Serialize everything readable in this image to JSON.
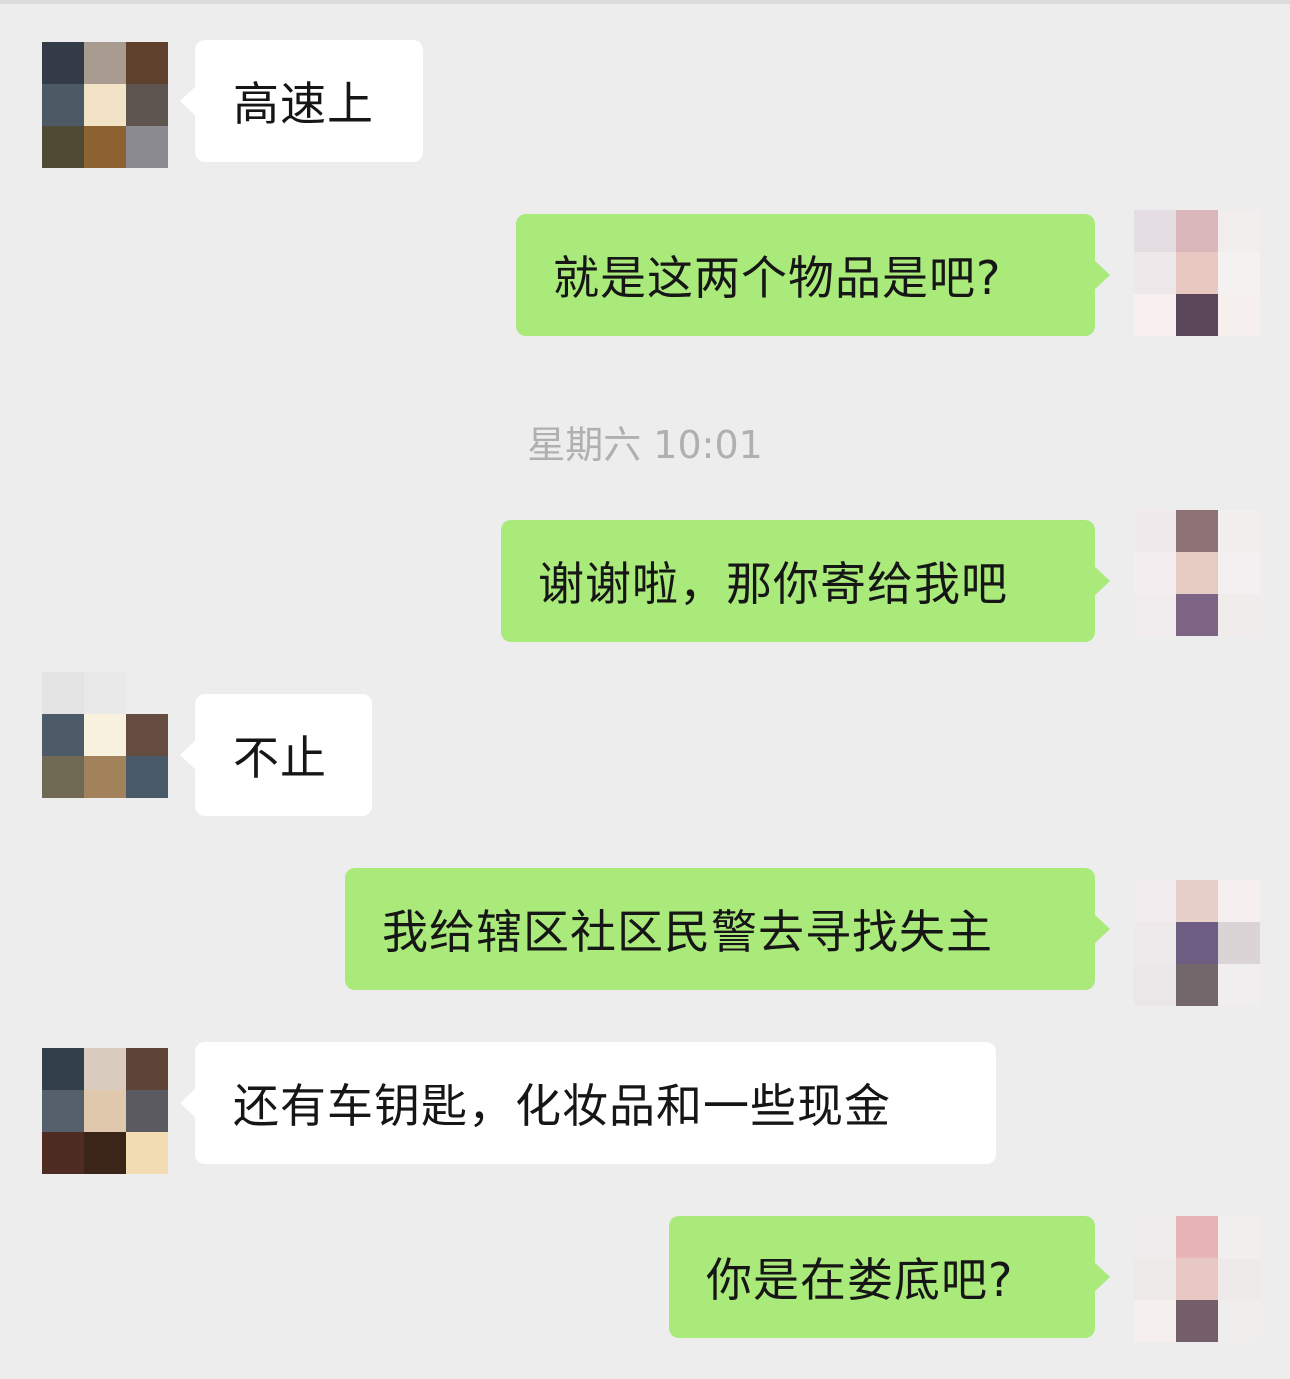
{
  "colors": {
    "background": "#ededed",
    "incoming_bubble": "#ffffff",
    "outgoing_bubble": "#a9ea7a",
    "timestamp_text": "#b0b0b0"
  },
  "timestamp": "星期六 10:01",
  "messages": [
    {
      "direction": "incoming",
      "text": "高速上"
    },
    {
      "direction": "outgoing",
      "text": "就是这两个物品是吧?"
    },
    {
      "direction": "outgoing",
      "text": "谢谢啦，那你寄给我吧"
    },
    {
      "direction": "incoming",
      "text": "不止"
    },
    {
      "direction": "outgoing",
      "text": "我给辖区社区民警去寻找失主"
    },
    {
      "direction": "incoming",
      "text": "还有车钥匙，化妆品和一些现金"
    },
    {
      "direction": "outgoing",
      "text": "你是在娄底吧?"
    }
  ],
  "avatars": {
    "contact_1": [
      "#333c46",
      "#a89b90",
      "#5e402c",
      "#4c5a66",
      "#f2e3c6",
      "#5e5450",
      "#4e4a33",
      "#8c6230",
      "#8a8a90"
    ],
    "self_1": [
      "#e4dde1",
      "#d9b7ba",
      "#f2eeee",
      "#efe8ea",
      "#e8c9c1",
      "#f4f1f1",
      "#f7eff0",
      "#5a4658",
      "#f5f0ed"
    ],
    "self_2": [
      "#f0eaec",
      "#8d7375",
      "#f2efef",
      "#f5eef0",
      "#e6cbc3",
      "#f3f0f1",
      "#f1eced",
      "#7d6485",
      "#f0ecec"
    ],
    "contact_2": [
      "#e4e4e4",
      "#e9e9e9",
      "#ededed",
      "#4d5a67",
      "#f7f1dd",
      "#654c40",
      "#706a55",
      "#a1825a",
      "#495a68"
    ],
    "self_3": [
      "#f2ecee",
      "#e7cfca",
      "#f6efef",
      "#eeeaeb",
      "#6f5e84",
      "#dad4d6",
      "#e9e7e7",
      "#74676c",
      "#f1eeef"
    ],
    "contact_3": [
      "#323e48",
      "#d9cbbd",
      "#5e4436",
      "#55606a",
      "#dfc8ab",
      "#5a5a60",
      "#4e2c24",
      "#3b2418",
      "#f2dcb4"
    ],
    "self_4": [
      "#eeecec",
      "#e8b4b6",
      "#f2efef",
      "#eeeaea",
      "#e7c8c2",
      "#eeeaea",
      "#f5efee",
      "#735e6a",
      "#f0eded"
    ]
  }
}
